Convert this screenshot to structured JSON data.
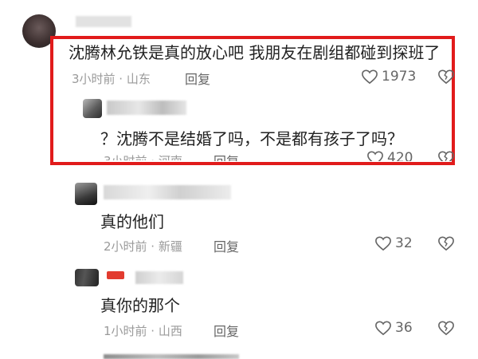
{
  "comments": [
    {
      "text": "沈腾林允铁是真的放心吧 我朋友在剧组都碰到探班了",
      "meta": "3小时前 · 山东",
      "reply": "回复",
      "likes": "1973"
    },
    {
      "text": "？沈腾不是结婚了吗，不是都有孩子了吗？",
      "meta": "3小时前 · 河南",
      "reply": "回复",
      "likes": "420"
    },
    {
      "text": "真的他们",
      "meta": "2小时前 · 新疆",
      "reply": "回复",
      "likes": "32"
    },
    {
      "text": "真你的那个",
      "meta": "1小时前 · 山西",
      "reply": "回复",
      "likes": "36"
    }
  ],
  "colors": {
    "highlight": "#e11b1b",
    "meta": "#9a9a9a"
  },
  "icons": [
    "heart-icon",
    "broken-heart-icon"
  ]
}
